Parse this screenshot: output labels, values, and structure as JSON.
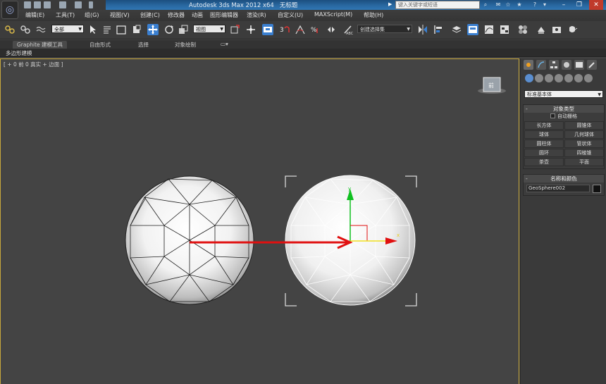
{
  "title_bar": {
    "app_title": "Autodesk 3ds Max  2012 x64",
    "doc_title": "无标题",
    "search_placeholder": "键入关键字或短语"
  },
  "menu": {
    "items": [
      "编辑(E)",
      "工具(T)",
      "组(G)",
      "视图(V)",
      "创建(C)",
      "修改器",
      "动画",
      "图形编辑器",
      "渲染(R)",
      "自定义(U)",
      "MAXScript(M)",
      "帮助(H)"
    ]
  },
  "toolbar": {
    "selection_filter": "全部",
    "ref_coord": "视图",
    "named_selection": "创建选择集"
  },
  "ribbon": {
    "tabs": [
      "Graphite 建模工具",
      "自由形式",
      "选择",
      "对象绘制"
    ],
    "sub_label": "多边形建模"
  },
  "viewport": {
    "label": "[ + 0 前 0 真实 + 边面 ]",
    "viewcube_face": "前"
  },
  "command_panel": {
    "category": "标准基本体",
    "object_type_title": "对象类型",
    "autogrid_label": "自动栅格",
    "objects": [
      "长方体",
      "圆锥体",
      "球体",
      "几何球体",
      "圆柱体",
      "管状体",
      "圆环",
      "四棱锥",
      "茶壶",
      "平面"
    ],
    "name_color_title": "名称和颜色",
    "object_name": "GeoSphere002",
    "object_color": "#111111"
  },
  "colors": {
    "viewport_bg": "#444444",
    "arrow_red": "#e01010",
    "gizmo_green": "#10c020",
    "gizmo_yellow": "#f0e020",
    "selection_bracket": "#d8d8d8"
  }
}
